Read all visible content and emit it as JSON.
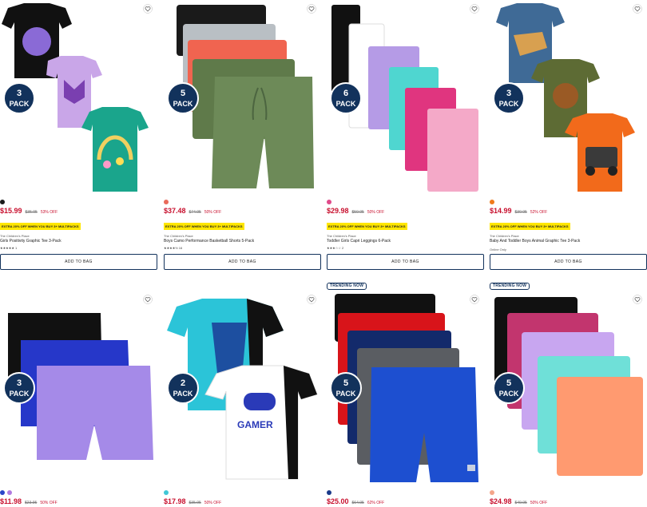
{
  "products": [
    {
      "pack": "3",
      "pack_word": "PACK",
      "swatch_colors": [
        "#1a1a1a"
      ],
      "price": "$15.99",
      "original_price": "$35.95",
      "discount": "53% OFF",
      "promo": "EXTRA 20% OFF WHEN YOU BUY 3+ MULTIPACKS",
      "brand": "The Children's Place",
      "title": "Girls Positivity Graphic Tee 3-Pack",
      "rating": "★★★★★ 1",
      "availability": "Online Only",
      "button": "ADD TO BAG",
      "palette": [
        "#111111",
        "#c9a6e8",
        "#1aa58c"
      ]
    },
    {
      "pack": "5",
      "pack_word": "PACK",
      "swatch_colors": [
        "#e96a5a"
      ],
      "price": "$37.48",
      "original_price": "$74.95",
      "discount": "50% OFF",
      "promo": "EXTRA 20% OFF WHEN YOU BUY 3+ MULTIPACKS",
      "brand": "The Children's Place",
      "title": "Boys Camo Performance Basketball Shorts 5-Pack",
      "rating": "★★★★½ 16",
      "availability": "",
      "button": "ADD TO BAG",
      "palette": [
        "#1a1a1a",
        "#b9bfc4",
        "#f06450",
        "#5f7a4a",
        "#6d8a58"
      ]
    },
    {
      "pack": "6",
      "pack_word": "PACK",
      "swatch_colors": [
        "#e04a8a"
      ],
      "price": "$29.98",
      "original_price": "$59.95",
      "discount": "50% OFF",
      "promo": "EXTRA 20% OFF WHEN YOU BUY 3+ MULTIPACKS",
      "brand": "The Children's Place",
      "title": "Toddler Girls Capri Leggings 6-Pack",
      "rating": "★★★☆☆ 2",
      "availability": "Online Only",
      "button": "ADD TO BAG",
      "palette": [
        "#111111",
        "#ffffff",
        "#b59be6",
        "#4fd6d0",
        "#e0357f",
        "#f4a9c8"
      ]
    },
    {
      "pack": "3",
      "pack_word": "PACK",
      "swatch_colors": [
        "#f07a1a"
      ],
      "price": "$14.99",
      "original_price": "$30.95",
      "discount": "52% OFF",
      "promo": "EXTRA 20% OFF WHEN YOU BUY 3+ MULTIPACKS",
      "brand": "The Children's Place",
      "title": "Baby And Toddler Boys Animal Graphic Tee 3-Pack",
      "rating": "",
      "availability": "Online Only",
      "button": "ADD TO BAG",
      "palette": [
        "#3f6a96",
        "#5d6b34",
        "#f26a1b"
      ]
    },
    {
      "pack": "3",
      "pack_word": "PACK",
      "swatch_colors": [
        "#2a45c8",
        "#b07ae0"
      ],
      "price": "$11.98",
      "original_price": "$23.95",
      "discount": "50% OFF",
      "button": "ADD TO BAG",
      "palette": [
        "#111111",
        "#2637c9",
        "#a58ae8"
      ]
    },
    {
      "pack": "2",
      "pack_word": "PACK",
      "swatch_colors": [
        "#3fc7d6"
      ],
      "price": "$17.98",
      "original_price": "$35.95",
      "discount": "50% OFF",
      "button": "ADD TO BAG",
      "palette": [
        "#2bc4d8",
        "#ffffff"
      ],
      "graphic_text": "GAMER"
    },
    {
      "pack": "5",
      "pack_word": "PACK",
      "trending": "TRENDING NOW",
      "swatch_colors": [
        "#1a3a8a"
      ],
      "price": "$25.00",
      "original_price": "$64.95",
      "discount": "62% OFF",
      "button": "ADD TO BAG",
      "palette": [
        "#111111",
        "#d8141a",
        "#132a6b",
        "#5a5d62",
        "#1d4fd0"
      ]
    },
    {
      "pack": "5",
      "pack_word": "PACK",
      "trending": "TRENDING NOW",
      "swatch_colors": [
        "#f4a58a"
      ],
      "price": "$24.98",
      "original_price": "$49.95",
      "discount": "50% OFF",
      "button": "ADD TO BAG",
      "palette": [
        "#111111",
        "#c2356e",
        "#c8a6f0",
        "#6fe0d8",
        "#ff9a70"
      ]
    }
  ],
  "icons": {
    "favorite": "heart-outline-icon"
  },
  "colors": {
    "price_red": "#c8102e",
    "pack_navy": "#12325c",
    "promo_yellow": "#ffe600"
  }
}
